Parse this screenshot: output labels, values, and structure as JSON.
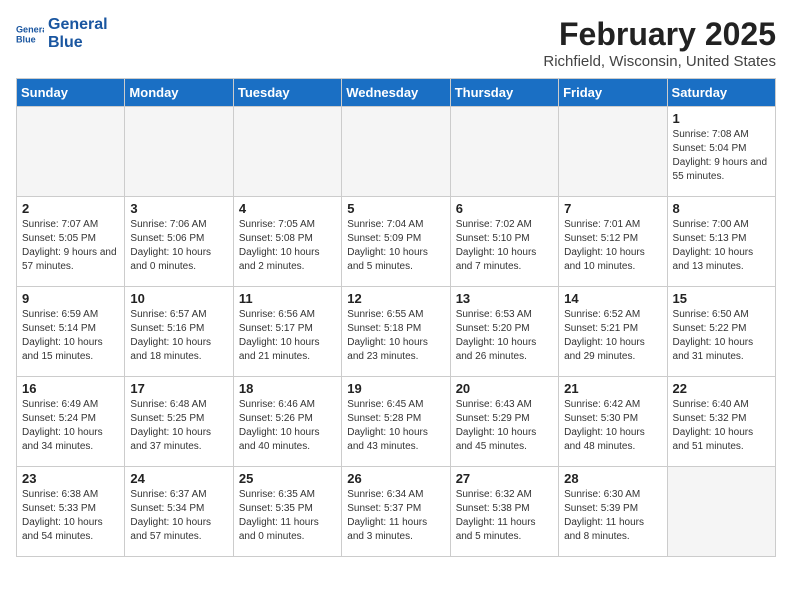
{
  "header": {
    "logo_line1": "General",
    "logo_line2": "Blue",
    "title": "February 2025",
    "subtitle": "Richfield, Wisconsin, United States"
  },
  "weekdays": [
    "Sunday",
    "Monday",
    "Tuesday",
    "Wednesday",
    "Thursday",
    "Friday",
    "Saturday"
  ],
  "weeks": [
    [
      {
        "day": "",
        "info": ""
      },
      {
        "day": "",
        "info": ""
      },
      {
        "day": "",
        "info": ""
      },
      {
        "day": "",
        "info": ""
      },
      {
        "day": "",
        "info": ""
      },
      {
        "day": "",
        "info": ""
      },
      {
        "day": "1",
        "info": "Sunrise: 7:08 AM\nSunset: 5:04 PM\nDaylight: 9 hours and 55 minutes."
      }
    ],
    [
      {
        "day": "2",
        "info": "Sunrise: 7:07 AM\nSunset: 5:05 PM\nDaylight: 9 hours and 57 minutes."
      },
      {
        "day": "3",
        "info": "Sunrise: 7:06 AM\nSunset: 5:06 PM\nDaylight: 10 hours and 0 minutes."
      },
      {
        "day": "4",
        "info": "Sunrise: 7:05 AM\nSunset: 5:08 PM\nDaylight: 10 hours and 2 minutes."
      },
      {
        "day": "5",
        "info": "Sunrise: 7:04 AM\nSunset: 5:09 PM\nDaylight: 10 hours and 5 minutes."
      },
      {
        "day": "6",
        "info": "Sunrise: 7:02 AM\nSunset: 5:10 PM\nDaylight: 10 hours and 7 minutes."
      },
      {
        "day": "7",
        "info": "Sunrise: 7:01 AM\nSunset: 5:12 PM\nDaylight: 10 hours and 10 minutes."
      },
      {
        "day": "8",
        "info": "Sunrise: 7:00 AM\nSunset: 5:13 PM\nDaylight: 10 hours and 13 minutes."
      }
    ],
    [
      {
        "day": "9",
        "info": "Sunrise: 6:59 AM\nSunset: 5:14 PM\nDaylight: 10 hours and 15 minutes."
      },
      {
        "day": "10",
        "info": "Sunrise: 6:57 AM\nSunset: 5:16 PM\nDaylight: 10 hours and 18 minutes."
      },
      {
        "day": "11",
        "info": "Sunrise: 6:56 AM\nSunset: 5:17 PM\nDaylight: 10 hours and 21 minutes."
      },
      {
        "day": "12",
        "info": "Sunrise: 6:55 AM\nSunset: 5:18 PM\nDaylight: 10 hours and 23 minutes."
      },
      {
        "day": "13",
        "info": "Sunrise: 6:53 AM\nSunset: 5:20 PM\nDaylight: 10 hours and 26 minutes."
      },
      {
        "day": "14",
        "info": "Sunrise: 6:52 AM\nSunset: 5:21 PM\nDaylight: 10 hours and 29 minutes."
      },
      {
        "day": "15",
        "info": "Sunrise: 6:50 AM\nSunset: 5:22 PM\nDaylight: 10 hours and 31 minutes."
      }
    ],
    [
      {
        "day": "16",
        "info": "Sunrise: 6:49 AM\nSunset: 5:24 PM\nDaylight: 10 hours and 34 minutes."
      },
      {
        "day": "17",
        "info": "Sunrise: 6:48 AM\nSunset: 5:25 PM\nDaylight: 10 hours and 37 minutes."
      },
      {
        "day": "18",
        "info": "Sunrise: 6:46 AM\nSunset: 5:26 PM\nDaylight: 10 hours and 40 minutes."
      },
      {
        "day": "19",
        "info": "Sunrise: 6:45 AM\nSunset: 5:28 PM\nDaylight: 10 hours and 43 minutes."
      },
      {
        "day": "20",
        "info": "Sunrise: 6:43 AM\nSunset: 5:29 PM\nDaylight: 10 hours and 45 minutes."
      },
      {
        "day": "21",
        "info": "Sunrise: 6:42 AM\nSunset: 5:30 PM\nDaylight: 10 hours and 48 minutes."
      },
      {
        "day": "22",
        "info": "Sunrise: 6:40 AM\nSunset: 5:32 PM\nDaylight: 10 hours and 51 minutes."
      }
    ],
    [
      {
        "day": "23",
        "info": "Sunrise: 6:38 AM\nSunset: 5:33 PM\nDaylight: 10 hours and 54 minutes."
      },
      {
        "day": "24",
        "info": "Sunrise: 6:37 AM\nSunset: 5:34 PM\nDaylight: 10 hours and 57 minutes."
      },
      {
        "day": "25",
        "info": "Sunrise: 6:35 AM\nSunset: 5:35 PM\nDaylight: 11 hours and 0 minutes."
      },
      {
        "day": "26",
        "info": "Sunrise: 6:34 AM\nSunset: 5:37 PM\nDaylight: 11 hours and 3 minutes."
      },
      {
        "day": "27",
        "info": "Sunrise: 6:32 AM\nSunset: 5:38 PM\nDaylight: 11 hours and 5 minutes."
      },
      {
        "day": "28",
        "info": "Sunrise: 6:30 AM\nSunset: 5:39 PM\nDaylight: 11 hours and 8 minutes."
      },
      {
        "day": "",
        "info": ""
      }
    ]
  ]
}
